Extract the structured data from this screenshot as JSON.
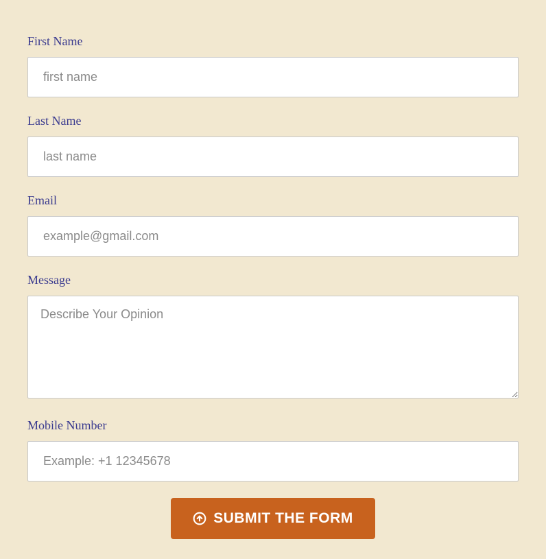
{
  "form": {
    "firstName": {
      "label": "First Name",
      "placeholder": "first name",
      "value": ""
    },
    "lastName": {
      "label": "Last Name",
      "placeholder": "last name",
      "value": ""
    },
    "email": {
      "label": "Email",
      "placeholder": "example@gmail.com",
      "value": ""
    },
    "message": {
      "label": "Message",
      "placeholder": "Describe Your Opinion",
      "value": ""
    },
    "mobile": {
      "label": "Mobile Number",
      "placeholder": "Example: +1 12345678",
      "value": ""
    },
    "submit": {
      "label": "SUBMIT THE FORM"
    }
  }
}
